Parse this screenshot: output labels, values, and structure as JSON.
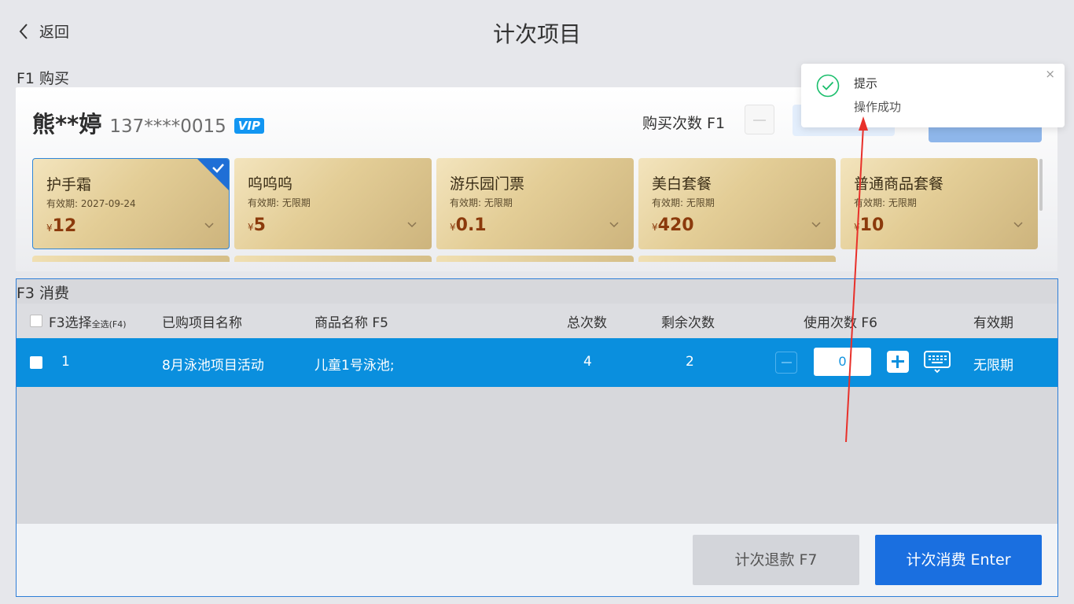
{
  "header": {
    "back_label": "返回",
    "title": "计次项目"
  },
  "buy_section": {
    "label": "F1 购买",
    "member": {
      "name": "熊**婷",
      "phone": "137****0015",
      "badge": "VIP"
    },
    "buy_count_label": "购买次数 F1",
    "cards": [
      {
        "name": "护手霜",
        "expiry": "有效期: 2027-09-24",
        "currency": "¥",
        "price": "12",
        "selected": true
      },
      {
        "name": "呜呜呜",
        "expiry": "有效期: 无限期",
        "currency": "¥",
        "price": "5",
        "selected": false
      },
      {
        "name": "游乐园门票",
        "expiry": "有效期: 无限期",
        "currency": "¥",
        "price": "0.1",
        "selected": false
      },
      {
        "name": "美白套餐",
        "expiry": "有效期: 无限期",
        "currency": "¥",
        "price": "420",
        "selected": false
      },
      {
        "name": "普通商品套餐",
        "expiry": "有效期: 无限期",
        "currency": "¥",
        "price": "10",
        "selected": false
      }
    ]
  },
  "toast": {
    "title": "提示",
    "message": "操作成功",
    "close": "×"
  },
  "consume_section": {
    "label": "F3 消费",
    "columns": {
      "select": "F3选择",
      "select_all": "全选(F4)",
      "project_name": "已购项目名称",
      "product_name": "商品名称 F5",
      "total": "总次数",
      "remaining": "剩余次数",
      "use_count": "使用次数 F6",
      "expiry": "有效期"
    },
    "rows": [
      {
        "index": "1",
        "project_name": "8月泳池项目活动",
        "product_name": "儿童1号泳池;",
        "total": "4",
        "remaining": "2",
        "use_count": "0",
        "expiry": "无限期"
      }
    ],
    "refund_label": "计次退款 F7",
    "consume_label": "计次消费 Enter"
  },
  "colors": {
    "primary": "#1a6fe0",
    "row_selected": "#0a8fde",
    "success": "#19be6b",
    "annotation_arrow": "#e8302a"
  }
}
